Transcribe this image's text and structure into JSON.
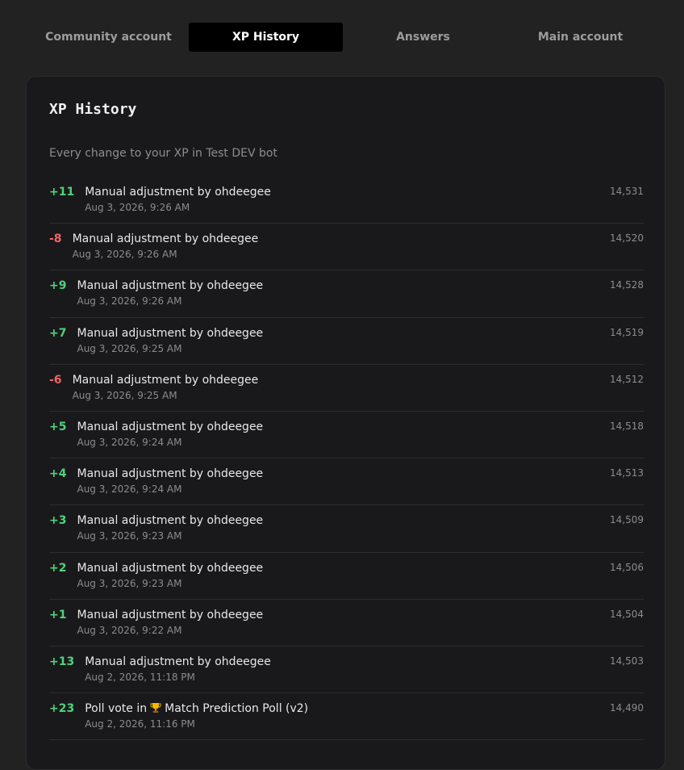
{
  "tabs": [
    {
      "label": "Community account",
      "active": false
    },
    {
      "label": "XP History",
      "active": true
    },
    {
      "label": "Answers",
      "active": false
    },
    {
      "label": "Main account",
      "active": false
    }
  ],
  "card": {
    "title": "XP History",
    "subtitle": "Every change to your XP in Test DEV bot"
  },
  "history": [
    {
      "delta": "+11",
      "sign": "pos",
      "description": "Manual adjustment by ohdeegee",
      "date": "Aug 3, 2026, 9:26 AM",
      "total": "14,531"
    },
    {
      "delta": "-8",
      "sign": "neg",
      "description": "Manual adjustment by ohdeegee",
      "date": "Aug 3, 2026, 9:26 AM",
      "total": "14,520"
    },
    {
      "delta": "+9",
      "sign": "pos",
      "description": "Manual adjustment by ohdeegee",
      "date": "Aug 3, 2026, 9:26 AM",
      "total": "14,528"
    },
    {
      "delta": "+7",
      "sign": "pos",
      "description": "Manual adjustment by ohdeegee",
      "date": "Aug 3, 2026, 9:25 AM",
      "total": "14,519"
    },
    {
      "delta": "-6",
      "sign": "neg",
      "description": "Manual adjustment by ohdeegee",
      "date": "Aug 3, 2026, 9:25 AM",
      "total": "14,512"
    },
    {
      "delta": "+5",
      "sign": "pos",
      "description": "Manual adjustment by ohdeegee",
      "date": "Aug 3, 2026, 9:24 AM",
      "total": "14,518"
    },
    {
      "delta": "+4",
      "sign": "pos",
      "description": "Manual adjustment by ohdeegee",
      "date": "Aug 3, 2026, 9:24 AM",
      "total": "14,513"
    },
    {
      "delta": "+3",
      "sign": "pos",
      "description": "Manual adjustment by ohdeegee",
      "date": "Aug 3, 2026, 9:23 AM",
      "total": "14,509"
    },
    {
      "delta": "+2",
      "sign": "pos",
      "description": "Manual adjustment by ohdeegee",
      "date": "Aug 3, 2026, 9:23 AM",
      "total": "14,506"
    },
    {
      "delta": "+1",
      "sign": "pos",
      "description": "Manual adjustment by ohdeegee",
      "date": "Aug 3, 2026, 9:22 AM",
      "total": "14,504"
    },
    {
      "delta": "+13",
      "sign": "pos",
      "description": "Manual adjustment by ohdeegee",
      "date": "Aug 2, 2026, 11:18 PM",
      "total": "14,503"
    },
    {
      "delta": "+23",
      "sign": "pos",
      "description_prefix": "Poll vote in",
      "icon": "trophy-icon",
      "description_suffix": "Match Prediction Poll (v2)",
      "date": "Aug 2, 2026, 11:16 PM",
      "total": "14,490"
    }
  ]
}
